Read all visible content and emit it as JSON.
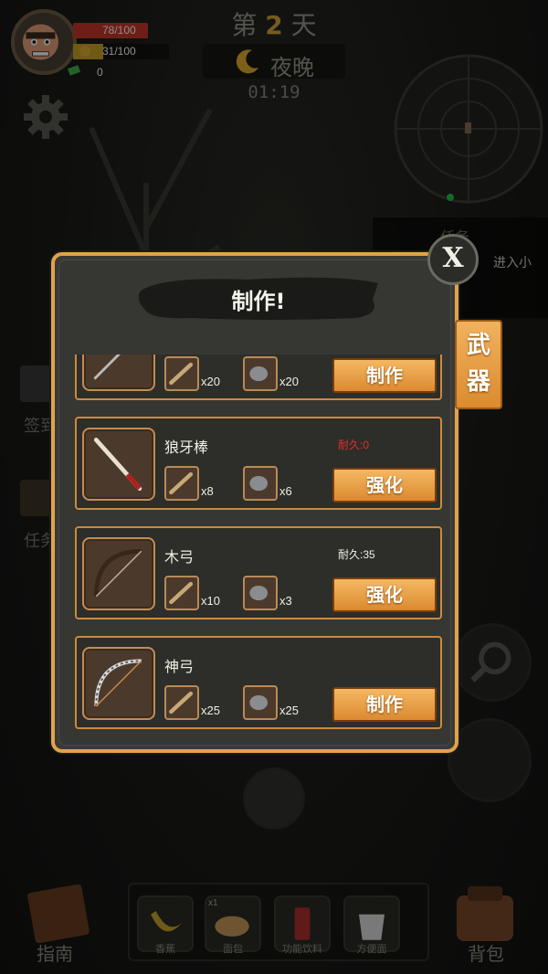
{
  "hud": {
    "hp_text": "78/100",
    "hp_value": 78,
    "hp_max": 100,
    "food_text": "31/100",
    "food_value": 31,
    "food_max": 100,
    "money": "0"
  },
  "clock": {
    "day_prefix": "第",
    "day_number": "2",
    "day_suffix": "天",
    "phase": "夜晚",
    "time": "01:19"
  },
  "side": {
    "task_title": "任务",
    "task_enter": "进入小",
    "signin_label": "签到",
    "task_label": "任务"
  },
  "modal": {
    "title": "制作!",
    "close": "X",
    "tab": "武器",
    "items": [
      {
        "name": "",
        "durability": "",
        "mat1_qty": "x20",
        "mat2_qty": "x20",
        "action": "制作",
        "icon": "spear-icon"
      },
      {
        "name": "狼牙棒",
        "durability": "耐久:0",
        "durability_color": "#e0302a",
        "mat1_qty": "x8",
        "mat2_qty": "x6",
        "action": "强化",
        "icon": "spiked-club-icon"
      },
      {
        "name": "木弓",
        "durability": "耐久:35",
        "durability_color": "#f0f0e6",
        "mat1_qty": "x10",
        "mat2_qty": "x3",
        "action": "强化",
        "icon": "wooden-bow-icon"
      },
      {
        "name": "神弓",
        "durability": "",
        "mat1_qty": "x25",
        "mat2_qty": "x25",
        "action": "制作",
        "icon": "divine-bow-icon"
      }
    ]
  },
  "bottom": {
    "guide_label": "指南",
    "bag_label": "背包",
    "slots": [
      "香蕉",
      "面包",
      "功能饮料",
      "方便面"
    ],
    "slot_badge": "x1"
  }
}
